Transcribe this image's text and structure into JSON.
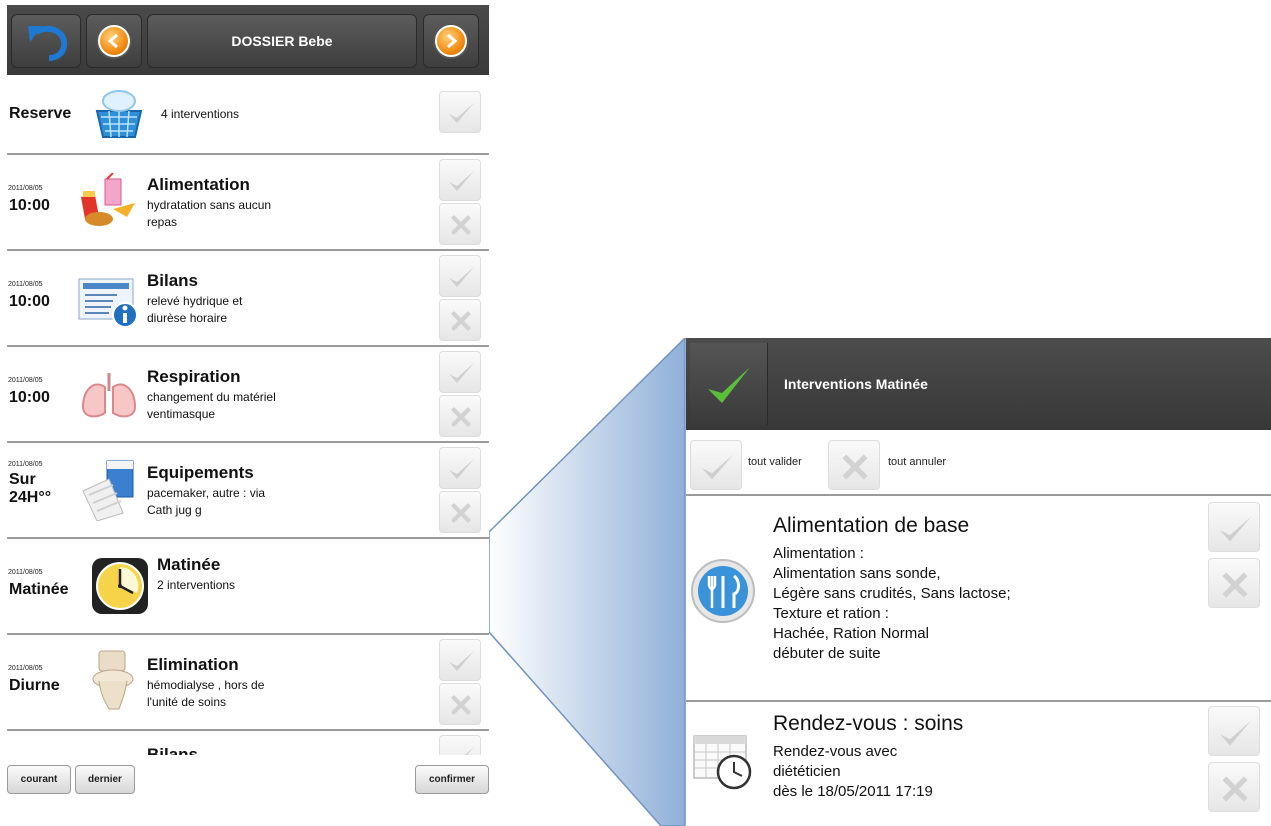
{
  "left": {
    "header": {
      "title": "DOSSIER Bebe"
    },
    "reserve": {
      "label": "Reserve",
      "text": "4 interventions"
    },
    "rows": [
      {
        "date": "2011/08/05",
        "time": "10:00",
        "title": "Alimentation",
        "desc1": "hydratation sans aucun",
        "desc2": "repas",
        "icon": "food-icon"
      },
      {
        "date": "2011/08/05",
        "time": "10:00",
        "title": "Bilans",
        "desc1": "relevé hydrique et",
        "desc2": "diurèse horaire",
        "icon": "chart-info-icon"
      },
      {
        "date": "2011/08/05",
        "time": "10:00",
        "title": "Respiration",
        "desc1": "changement du matériel",
        "desc2": "ventimasque",
        "icon": "lungs-icon"
      },
      {
        "date": "2011/08/05",
        "time1": "Sur",
        "time2": "24H°°",
        "title": "Equipements",
        "desc1": "pacemaker, autre : via",
        "desc2": "Cath jug g",
        "icon": "bandage-icon"
      },
      {
        "date": "2011/08/05",
        "time": "Matinée",
        "title": "Matinée",
        "desc1": "2 interventions",
        "icon": "clock-icon"
      },
      {
        "date": "2011/08/05",
        "time": "Diurne",
        "title": "Elimination",
        "desc1": "hémodialyse , hors de",
        "desc2": "l'unité de soins",
        "icon": "toilet-icon"
      },
      {
        "title": "Bilans"
      }
    ],
    "footer": {
      "current": "courant",
      "last": "dernier",
      "confirm": "confirmer"
    }
  },
  "right": {
    "header": {
      "title": "Interventions Matinée"
    },
    "bulk": {
      "validate_all": "tout valider",
      "cancel_all": "tout annuler"
    },
    "items": [
      {
        "title": "Alimentation de base",
        "lines": [
          "Alimentation :",
          "Alimentation sans sonde,",
          "Légère sans crudités, Sans lactose;",
          "Texture et ration :",
          "Hachée, Ration Normal",
          "débuter de suite"
        ],
        "icon": "cutlery-icon"
      },
      {
        "title": "Rendez-vous : soins",
        "lines": [
          "Rendez-vous  avec",
          "diététicien",
          "dès le 18/05/2011 17:19"
        ],
        "icon": "calendar-clock-icon"
      }
    ]
  }
}
